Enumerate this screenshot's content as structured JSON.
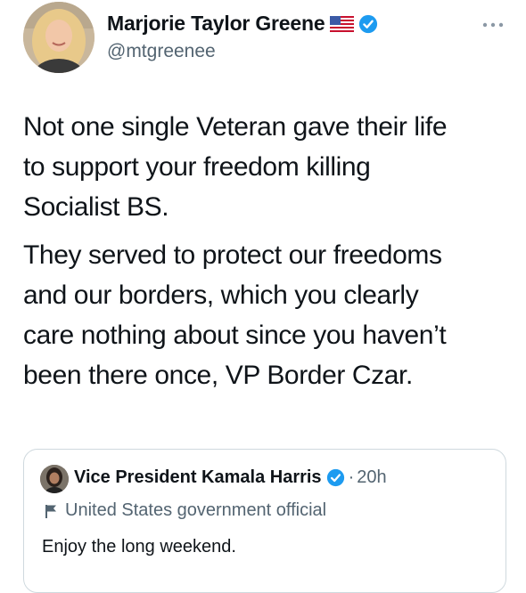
{
  "author": {
    "display_name": "Marjorie Taylor Greene",
    "handle": "@mtgreenee",
    "avatar_icon": "profile-photo",
    "flag_icon": "us-flag-icon",
    "verified": true
  },
  "menu": {
    "more_icon": "more-horizontal-icon"
  },
  "tweet": {
    "paragraphs": [
      "Not one single Veteran gave their life\nto support your freedom killing\nSocialist BS.",
      "They served to protect our freedoms\nand our borders, which you clearly\ncare nothing about since you haven’t\nbeen there once, VP Border Czar."
    ]
  },
  "quoted_tweet": {
    "display_name": "Vice President Kamala Harris",
    "separator": "·",
    "time": "20h",
    "label": "United States government official",
    "text": "Enjoy the long weekend.",
    "verified": true
  },
  "colors": {
    "verified_blue": "#1d9bf0",
    "secondary_text": "#536471",
    "border": "#cfd9de",
    "text": "#0f1419"
  }
}
